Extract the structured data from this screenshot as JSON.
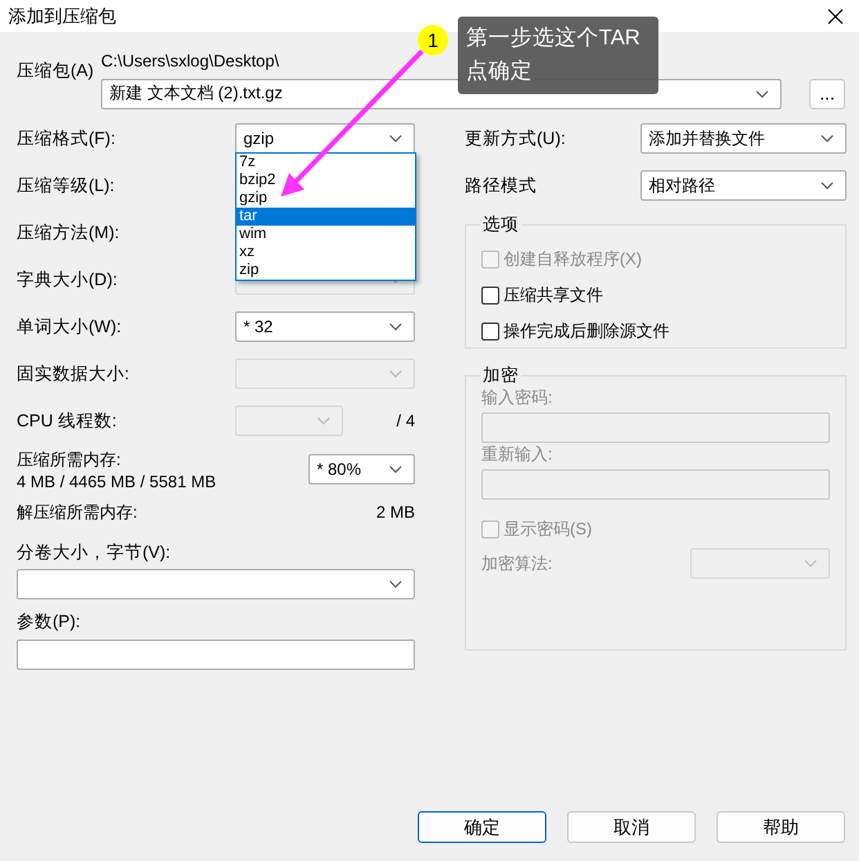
{
  "window": {
    "title": "添加到压缩包"
  },
  "archive": {
    "label": "压缩包(A)",
    "path": "C:\\Users\\sxlog\\Desktop\\",
    "value": "新建 文本文档 (2).txt.gz",
    "browse": "..."
  },
  "left": [
    {
      "kind": "combo",
      "label": "压缩格式(F):",
      "value": "gzip",
      "disabled": false
    },
    {
      "kind": "label",
      "label": "压缩等级(L):"
    },
    {
      "kind": "label",
      "label": "压缩方法(M):"
    },
    {
      "kind": "combo",
      "label": "字典大小(D):",
      "disabled": true
    },
    {
      "kind": "combo",
      "label": "单词大小(W):",
      "value": "* 32",
      "disabled": false
    },
    {
      "kind": "combo",
      "label": "固实数据大小:",
      "disabled": true
    },
    {
      "kind": "short-combo",
      "label": "CPU 线程数:",
      "disabled": true,
      "suffix": "/ 4"
    },
    {
      "kind": "memory",
      "label": "压缩所需内存:",
      "detail": "4 MB / 4465 MB / 5581 MB",
      "value": "* 80%",
      "disabled": false
    },
    {
      "kind": "info",
      "label": "解压缩所需内存:",
      "value": "2 MB"
    },
    {
      "kind": "wide-combo",
      "label": "分卷大小，字节(V):",
      "disabled": false
    },
    {
      "kind": "input",
      "label": "参数(P):",
      "disabled": false
    }
  ],
  "format_dropdown": {
    "options": [
      {
        "label": "7z",
        "selected": false
      },
      {
        "label": "bzip2",
        "selected": false
      },
      {
        "label": "gzip",
        "selected": false
      },
      {
        "label": "tar",
        "selected": true
      },
      {
        "label": "wim",
        "selected": false
      },
      {
        "label": "xz",
        "selected": false
      },
      {
        "label": "zip",
        "selected": false
      }
    ]
  },
  "right": [
    {
      "label": "更新方式(U):",
      "value": "添加并替换文件"
    },
    {
      "label": "路径模式",
      "value": "相对路径"
    }
  ],
  "options": {
    "title": "选项",
    "items": [
      {
        "label": "创建自释放程序(X)",
        "checked": false,
        "disabled": true
      },
      {
        "label": "压缩共享文件",
        "checked": false,
        "disabled": false
      },
      {
        "label": "操作完成后删除源文件",
        "checked": false,
        "disabled": false
      }
    ]
  },
  "encryption": {
    "title": "加密",
    "disabled": true,
    "password_label": "输入密码:",
    "reenter_label": "重新输入:",
    "show": {
      "label": "显示密码(S)",
      "checked": false
    },
    "method_label": "加密算法:"
  },
  "buttons": [
    {
      "label": "确定",
      "default": true
    },
    {
      "label": "取消",
      "default": false
    },
    {
      "label": "帮助",
      "default": false
    }
  ],
  "annotation": {
    "number": "1",
    "text": "第一步选这个TAR\n点确定"
  }
}
